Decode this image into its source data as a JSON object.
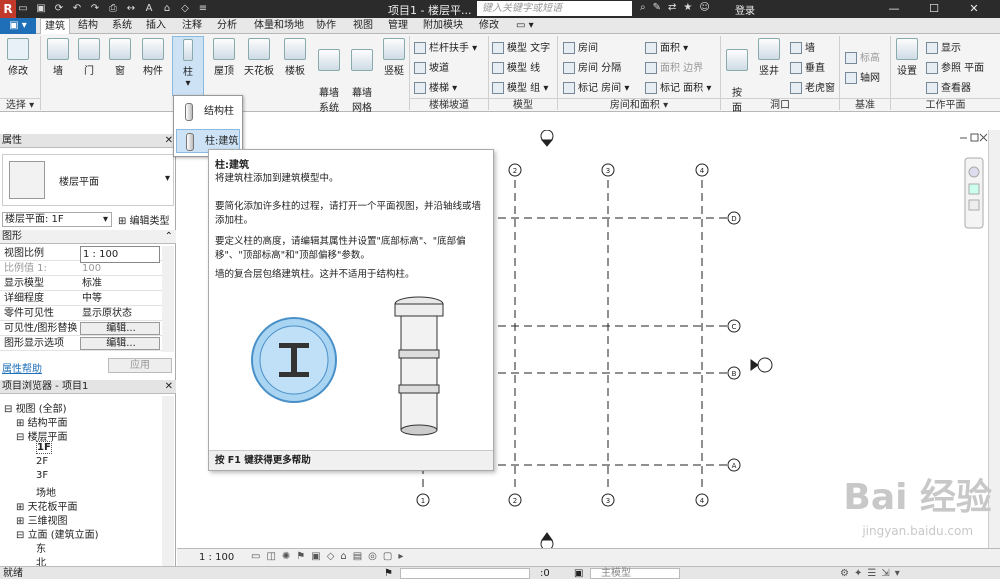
{
  "titlebar": {
    "title": "项目1 - 楼层平...",
    "search_placeholder": "键入关键字或短语",
    "login": "登录"
  },
  "tabs": [
    "建筑",
    "结构",
    "系统",
    "插入",
    "注释",
    "分析",
    "体量和场地",
    "协作",
    "视图",
    "管理",
    "附加模块",
    "修改"
  ],
  "ribbon": {
    "modify": "修改",
    "select": "选择",
    "wall": "墙",
    "door": "门",
    "window": "窗",
    "component": "构件",
    "column": "柱",
    "roof": "屋顶",
    "ceiling": "天花板",
    "floor": "楼板",
    "curtain_system": "幕墙\n系统",
    "curtain_grid": "幕墙\n网格",
    "mullion": "竖梃",
    "railing": "栏杆扶手",
    "ramp": "坡道",
    "stair": "楼梯",
    "model_text": "模型 文字",
    "model_line": "模型 线",
    "model_group": "模型 组",
    "room": "房间",
    "room_separator": "房间 分隔",
    "tag_room": "标记 房间",
    "area": "面积",
    "area_boundary": "面积 边界",
    "tag_area": "标记 面积",
    "by_face": "按\n面",
    "shaft": "竖井",
    "wall_opening": "墙",
    "vertical": "垂直",
    "dormer": "老虎窗",
    "level": "标高",
    "grid": "轴网",
    "set": "设置",
    "show": "显示",
    "ref_plane": "参照 平面",
    "viewer": "查看器",
    "panels": {
      "circulation": "楼梯坡道",
      "model": "模型",
      "room_area": "房间和面积",
      "opening": "洞口",
      "datum": "基准",
      "work_plane": "工作平面"
    }
  },
  "dropdown": {
    "structural_column": "结构柱",
    "architectural_column": "柱:建筑"
  },
  "tooltip": {
    "title": "柱:建筑",
    "p1": "将建筑柱添加到建筑模型中。",
    "p2": "要简化添加许多柱的过程，请打开一个平面视图，并沿轴线或墙添加柱。",
    "p3": "要定义柱的高度，请编辑其属性并设置\"底部标高\"、\"底部偏移\"、\"顶部标高\"和\"顶部偏移\"参数。",
    "p4": "墙的复合层包络建筑柱。这并不适用于结构柱。",
    "footer": "按 F1 键获得更多帮助"
  },
  "properties": {
    "header": "属性",
    "type_name": "楼层平面",
    "selector": "楼层平面: 1F",
    "edit_type": "编辑类型",
    "section": "图形",
    "rows": [
      {
        "k": "视图比例",
        "v": "1 : 100"
      },
      {
        "k": "比例值 1:",
        "v": "100"
      },
      {
        "k": "显示模型",
        "v": "标准"
      },
      {
        "k": "详细程度",
        "v": "中等"
      },
      {
        "k": "零件可见性",
        "v": "显示原状态"
      },
      {
        "k": "可见性/图形替换",
        "v": "编辑..."
      },
      {
        "k": "图形显示选项",
        "v": "编辑..."
      }
    ],
    "help": "属性帮助",
    "apply": "应用"
  },
  "browser": {
    "header": "项目浏览器 - 项目1",
    "items": [
      "视图 (全部)",
      "结构平面",
      "楼层平面",
      "1F",
      "2F",
      "3F",
      "场地",
      "天花板平面",
      "三维视图",
      "立面 (建筑立面)",
      "东",
      "北"
    ]
  },
  "grid_labels": {
    "top": [
      "2",
      "3",
      "4"
    ],
    "bottom": [
      "1",
      "2",
      "3",
      "4"
    ],
    "right": [
      "D",
      "C",
      "B",
      "A"
    ]
  },
  "viewbar": {
    "scale": "1 : 100"
  },
  "status": {
    "ready": "就绪",
    "count": ":0",
    "model": "主模型"
  },
  "watermark": {
    "brand": "Bai 经验",
    "url": "jingyan.baidu.com"
  },
  "colors": {
    "accent": "#1e6fb8",
    "selected": "#cde3f5"
  }
}
